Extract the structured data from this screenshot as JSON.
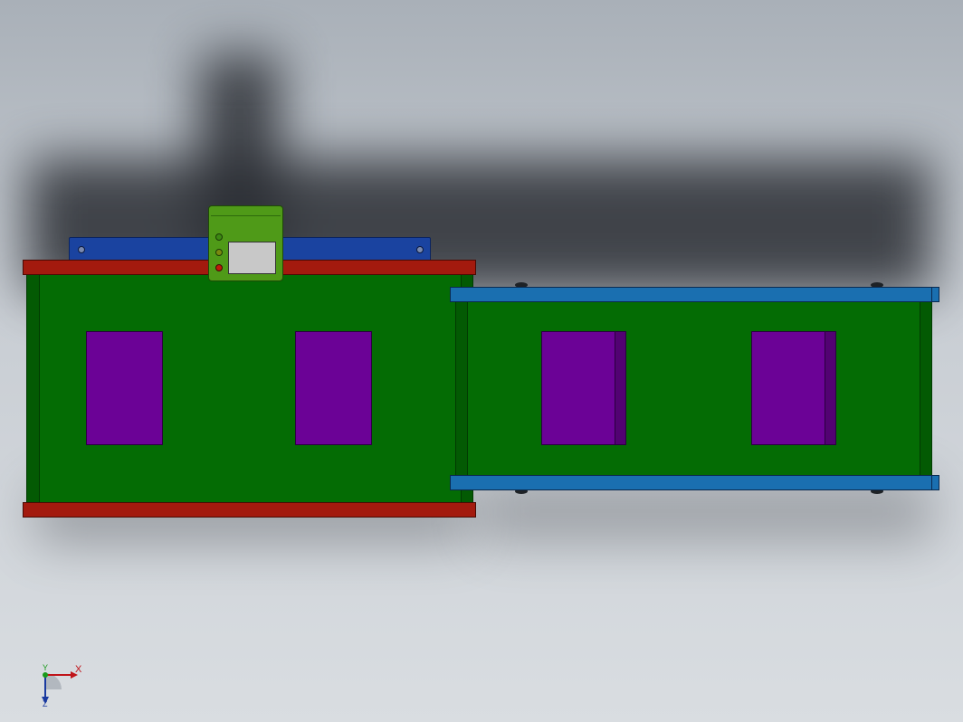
{
  "viewport": {
    "background_top": "#a9b0b8",
    "background_bottom": "#d9dde1"
  },
  "colors": {
    "rail_red": "#a31a0e",
    "panel_green": "#046c04",
    "panel_green_dark": "#035a03",
    "top_bar_blue": "#1a43a0",
    "window_purple": "#6b0296",
    "window_purple_side": "#520272",
    "rail_blue": "#1a6fb0",
    "control_box_green": "#4f9a18",
    "screen_gray": "#c8c8c8"
  },
  "triad": {
    "x_label": "X",
    "y_label": "Y",
    "z_label": "Z",
    "x_color": "#c0141a",
    "y_color": "#1a9a1a",
    "z_color": "#1a3aa0"
  },
  "icons": {
    "triad": "coordinate-triad-icon",
    "control_box": "control-box-icon"
  }
}
